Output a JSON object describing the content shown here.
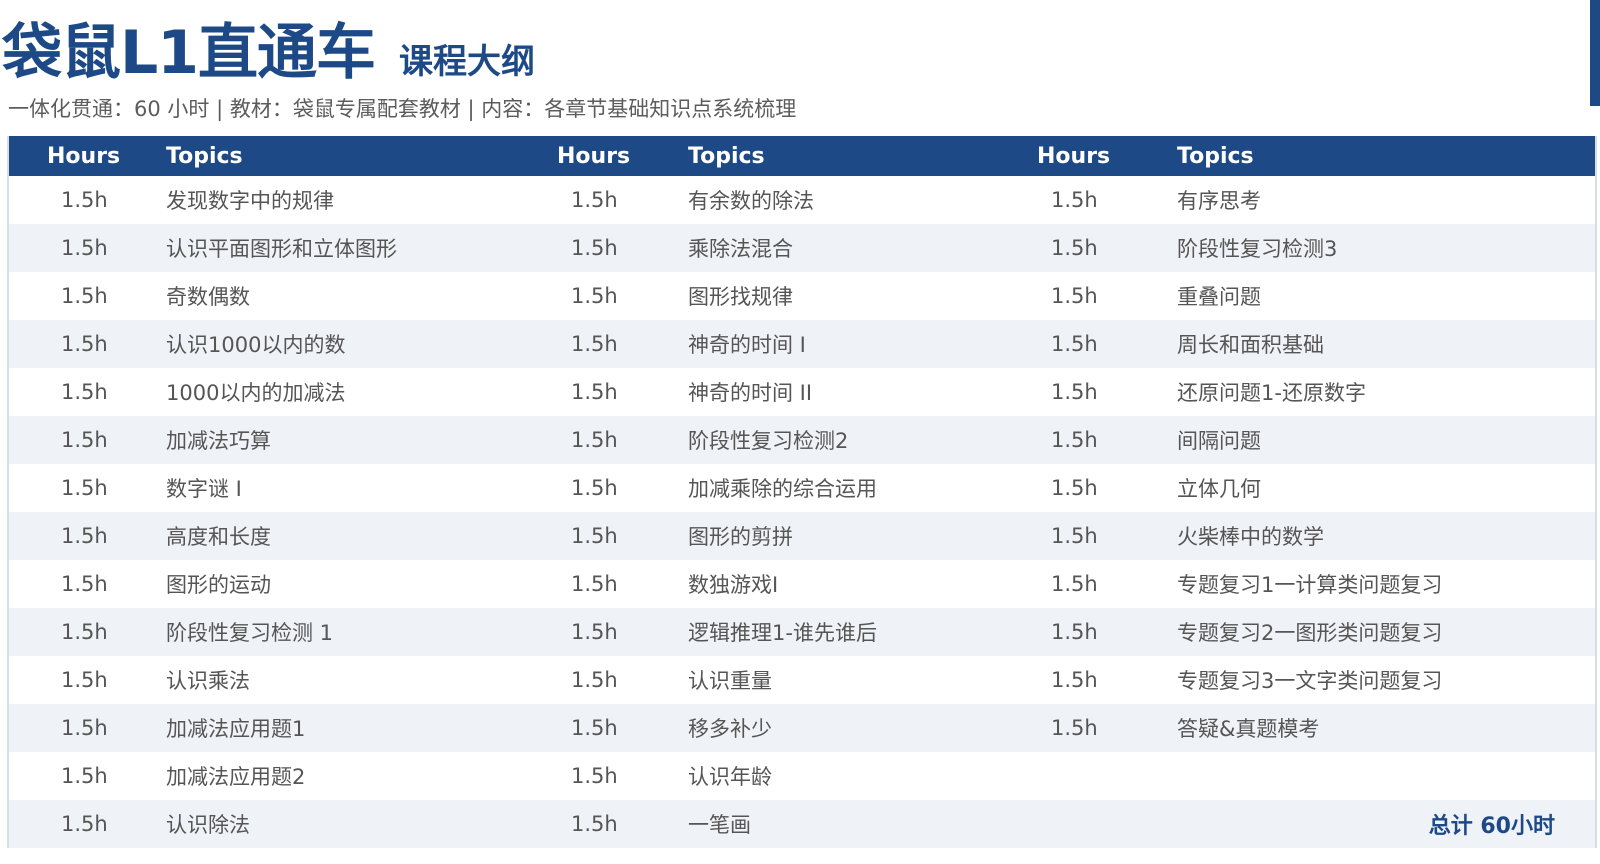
{
  "header": {
    "title": "袋鼠L1直通车",
    "subtitle_tag": "课程大纲",
    "description": "一体化贯通：60 小时 | 教材：袋鼠专属配套教材 | 内容：各章节基础知识点系统梳理"
  },
  "colors": {
    "brand": "#1d4a86",
    "row_alt": "#eff2f6",
    "text": "#555555"
  },
  "table": {
    "headers": [
      "Hours",
      "Topics",
      "Hours",
      "Topics",
      "Hours",
      "Topics"
    ],
    "rows": [
      {
        "h1": "1.5h",
        "t1": "发现数字中的规律",
        "h2": "1.5h",
        "t2": "有余数的除法",
        "h3": "1.5h",
        "t3": "有序思考"
      },
      {
        "h1": "1.5h",
        "t1": "认识平面图形和立体图形",
        "h2": "1.5h",
        "t2": "乘除法混合",
        "h3": "1.5h",
        "t3": "阶段性复习检测3"
      },
      {
        "h1": "1.5h",
        "t1": "奇数偶数",
        "h2": "1.5h",
        "t2": "图形找规律",
        "h3": "1.5h",
        "t3": "重叠问题"
      },
      {
        "h1": "1.5h",
        "t1": "认识1000以内的数",
        "h2": "1.5h",
        "t2": "神奇的时间 I",
        "h3": "1.5h",
        "t3": "周长和面积基础"
      },
      {
        "h1": "1.5h",
        "t1": "1000以内的加减法",
        "h2": "1.5h",
        "t2": "神奇的时间 II",
        "h3": "1.5h",
        "t3": "还原问题1-还原数字"
      },
      {
        "h1": "1.5h",
        "t1": "加减法巧算",
        "h2": "1.5h",
        "t2": "阶段性复习检测2",
        "h3": "1.5h",
        "t3": "间隔问题"
      },
      {
        "h1": "1.5h",
        "t1": "数字谜 I",
        "h2": "1.5h",
        "t2": "加减乘除的综合运用",
        "h3": "1.5h",
        "t3": "立体几何"
      },
      {
        "h1": "1.5h",
        "t1": "高度和长度",
        "h2": "1.5h",
        "t2": "图形的剪拼",
        "h3": "1.5h",
        "t3": "火柴棒中的数学"
      },
      {
        "h1": "1.5h",
        "t1": "图形的运动",
        "h2": "1.5h",
        "t2": "数独游戏I",
        "h3": "1.5h",
        "t3": "专题复习1一计算类问题复习"
      },
      {
        "h1": "1.5h",
        "t1": "阶段性复习检测 1",
        "h2": "1.5h",
        "t2": "逻辑推理1-谁先谁后",
        "h3": "1.5h",
        "t3": "专题复习2一图形类问题复习"
      },
      {
        "h1": "1.5h",
        "t1": "认识乘法",
        "h2": "1.5h",
        "t2": "认识重量",
        "h3": "1.5h",
        "t3": "专题复习3一文字类问题复习"
      },
      {
        "h1": "1.5h",
        "t1": "加减法应用题1",
        "h2": "1.5h",
        "t2": "移多补少",
        "h3": "1.5h",
        "t3": "答疑&真题模考"
      },
      {
        "h1": "1.5h",
        "t1": "加减法应用题2",
        "h2": "1.5h",
        "t2": "认识年龄",
        "h3": "",
        "t3": ""
      },
      {
        "h1": "1.5h",
        "t1": "认识除法",
        "h2": "1.5h",
        "t2": "一笔画",
        "h3": "",
        "t3": ""
      }
    ],
    "total": "总计 60小时"
  }
}
